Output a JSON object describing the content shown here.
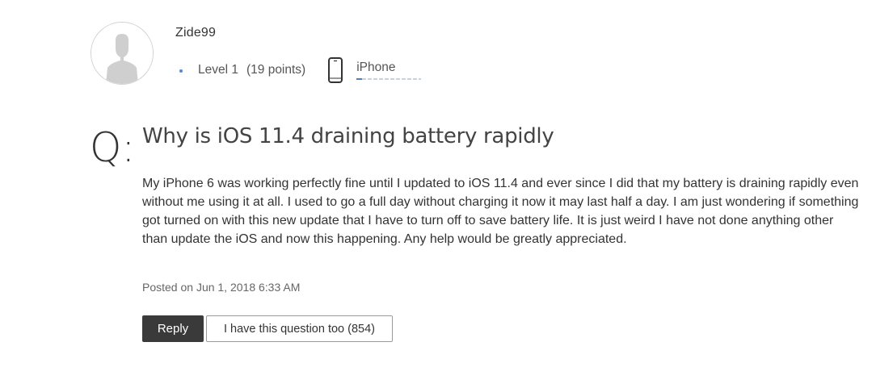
{
  "author": {
    "username": "Zide99",
    "level": "Level 1",
    "points": "(19 points)",
    "device": "iPhone",
    "avatar_icon": "user-silhouette-icon",
    "device_icon": "iphone-icon"
  },
  "question": {
    "marker": "Q:",
    "title": "Why is iOS 11.4 draining battery rapidly",
    "body": "My iPhone 6 was working perfectly fine until I updated to iOS 11.4 and ever since I did that my battery is draining rapidly even without me using it at all. I used to go a full day without charging it now it may last half a day. I am just wondering if something got turned on with this new update that I have to turn off to save battery life. It is just weird I have not done anything other than update the iOS and now this happening. Any help would be greatly appreciated.",
    "posted": "Posted on Jun 1, 2018 6:33 AM"
  },
  "actions": {
    "reply_label": "Reply",
    "same_question_label": "I have this question too",
    "same_question_count": "(854)"
  },
  "colors": {
    "reply_bg": "#3a3a3a",
    "bullet": "#4e8cd8",
    "text": "#333333"
  }
}
